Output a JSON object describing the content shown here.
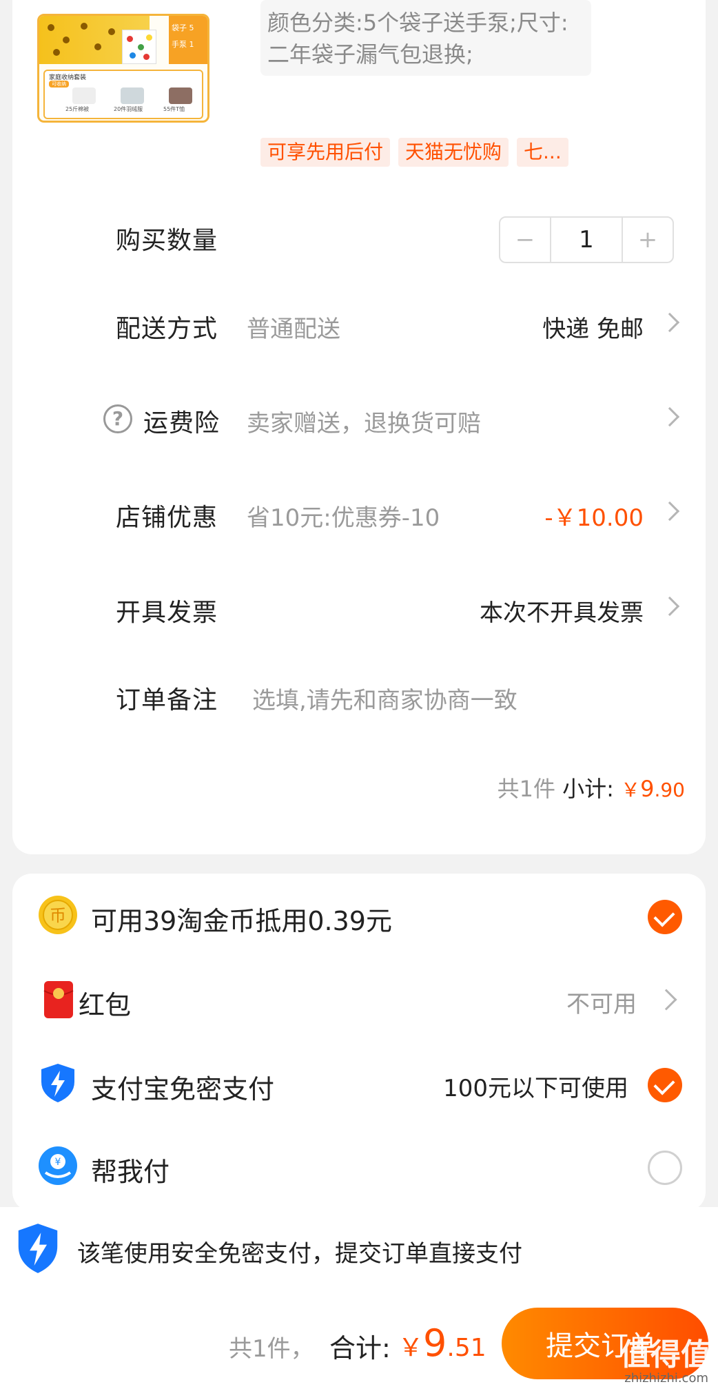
{
  "product": {
    "thumb_tag_line1": "袋子",
    "thumb_tag_line2": "手泵",
    "thumb_tag_num1": "5",
    "thumb_tag_num2": "1",
    "thumb_lower_title": "家庭收纳套装",
    "thumb_lower_pill": "可收纳",
    "thumb_caption1": "25斤棉被",
    "thumb_caption2": "20件羽绒服",
    "thumb_caption3": "55件T恤",
    "spec": "颜色分类:5个袋子送手泵;尺寸:二年袋子漏气包退换;",
    "badges": [
      "可享先用后付",
      "天猫无忧购",
      "七..."
    ]
  },
  "quantity": {
    "label": "购买数量",
    "value": "1",
    "minus": "−",
    "plus": "+"
  },
  "delivery": {
    "label": "配送方式",
    "sub": "普通配送",
    "value": "快递 免邮"
  },
  "insurance": {
    "icon": "?",
    "label": "运费险",
    "sub": "卖家赠送，退换货可赔"
  },
  "shop_discount": {
    "label": "店铺优惠",
    "sub": "省10元:优惠券-10",
    "value": "-￥10.00"
  },
  "invoice": {
    "label": "开具发票",
    "value": "本次不开具发票"
  },
  "note": {
    "label": "订单备注",
    "placeholder": "选填,请先和商家协商一致"
  },
  "subtotal": {
    "count": "共1件",
    "label": "小计:",
    "currency": "￥",
    "int": "9",
    "dec": ".90"
  },
  "payment": {
    "coins": {
      "text": "可用39淘金币抵用0.39元",
      "checked": true
    },
    "redpacket": {
      "text": "红包",
      "status": "不可用"
    },
    "alipay": {
      "text": "支付宝免密支付",
      "status": "100元以下可使用",
      "checked": true
    },
    "helppay": {
      "text": "帮我付",
      "checked": false
    }
  },
  "notice": {
    "text": "该笔使用安全免密支付，提交订单直接支付"
  },
  "bottom": {
    "count": "共1件，",
    "total_label": "合计:",
    "currency": "￥",
    "int": "9",
    "dec": ".51",
    "submit": "提交订单"
  },
  "watermark": {
    "main": "值得值",
    "sub": "zhizhizhi.com"
  },
  "colors": {
    "accent": "#ff5000",
    "bg": "#f2f2f2"
  }
}
